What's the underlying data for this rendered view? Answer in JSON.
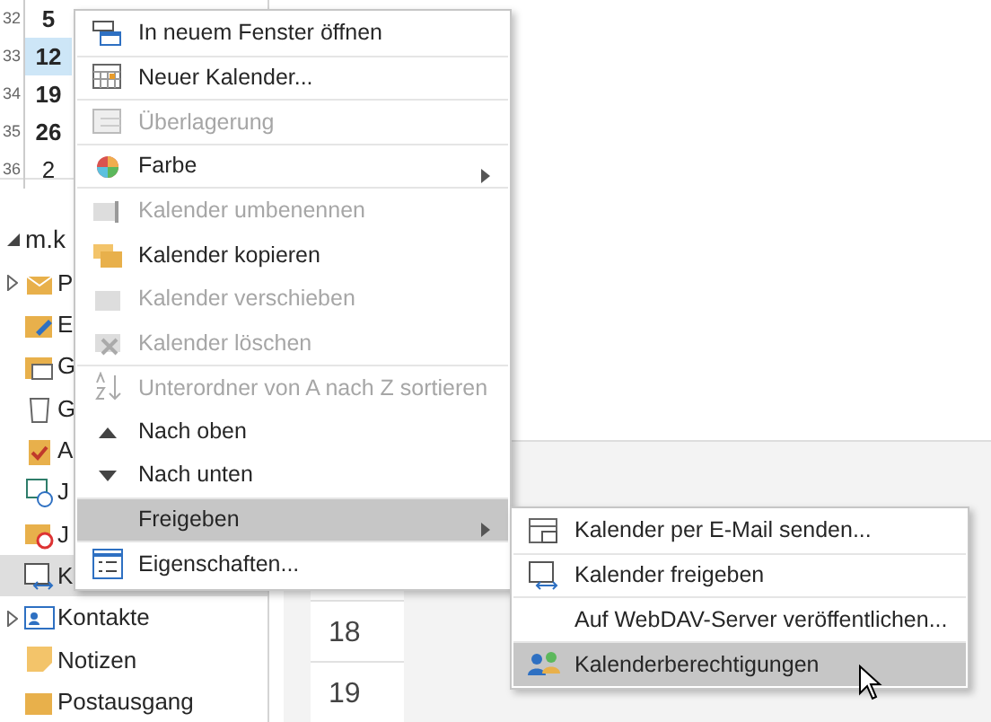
{
  "mini_calendar": {
    "rows": [
      {
        "week": "32",
        "day": "5",
        "selected": false
      },
      {
        "week": "33",
        "day": "12",
        "selected": true
      },
      {
        "week": "34",
        "day": "19",
        "selected": false
      },
      {
        "week": "35",
        "day": "26",
        "selected": false
      },
      {
        "week": "36",
        "day": "2",
        "selected": false
      }
    ]
  },
  "folder_tree": {
    "account": "m.k",
    "items": [
      {
        "label": "P",
        "expandable": true,
        "selected": false
      },
      {
        "label": "E",
        "expandable": false,
        "selected": false
      },
      {
        "label": "G",
        "expandable": false,
        "selected": false
      },
      {
        "label": "G",
        "expandable": false,
        "selected": false
      },
      {
        "label": "A",
        "expandable": false,
        "selected": false
      },
      {
        "label": "J",
        "expandable": false,
        "selected": false
      },
      {
        "label": "J",
        "expandable": false,
        "selected": false
      },
      {
        "label": "K",
        "expandable": false,
        "selected": true
      },
      {
        "label": "Kontakte",
        "expandable": true,
        "selected": false
      },
      {
        "label": "Notizen",
        "expandable": false,
        "selected": false
      },
      {
        "label": "Postausgang",
        "expandable": false,
        "selected": false
      }
    ]
  },
  "day_view": {
    "days": [
      "18",
      "19"
    ]
  },
  "context_menu": {
    "items": [
      {
        "label": "In neuem Fenster öffnen",
        "disabled": false,
        "submenu": false,
        "selected": false
      },
      {
        "label": "Neuer Kalender...",
        "disabled": false,
        "submenu": false,
        "selected": false
      },
      {
        "label": "Überlagerung",
        "disabled": true,
        "submenu": false,
        "selected": false
      },
      {
        "label": "Farbe",
        "disabled": false,
        "submenu": true,
        "selected": false
      },
      {
        "label": "Kalender umbenennen",
        "disabled": true,
        "submenu": false,
        "selected": false
      },
      {
        "label": "Kalender kopieren",
        "disabled": false,
        "submenu": false,
        "selected": false
      },
      {
        "label": "Kalender verschieben",
        "disabled": true,
        "submenu": false,
        "selected": false
      },
      {
        "label": "Kalender löschen",
        "disabled": true,
        "submenu": false,
        "selected": false
      },
      {
        "label": "Unterordner von A nach Z sortieren",
        "disabled": true,
        "submenu": false,
        "selected": false
      },
      {
        "label": "Nach oben",
        "disabled": false,
        "submenu": false,
        "selected": false
      },
      {
        "label": "Nach unten",
        "disabled": false,
        "submenu": false,
        "selected": false
      },
      {
        "label": "Freigeben",
        "disabled": false,
        "submenu": true,
        "selected": true
      },
      {
        "label": "Eigenschaften...",
        "disabled": false,
        "submenu": false,
        "selected": false
      }
    ]
  },
  "submenu": {
    "items": [
      {
        "label": "Kalender per E-Mail senden...",
        "disabled": false,
        "selected": false
      },
      {
        "label": "Kalender freigeben",
        "disabled": false,
        "selected": false
      },
      {
        "label": "Auf WebDAV-Server veröffentlichen...",
        "disabled": false,
        "selected": false
      },
      {
        "label": "Kalenderberechtigungen",
        "disabled": false,
        "selected": true
      }
    ]
  }
}
